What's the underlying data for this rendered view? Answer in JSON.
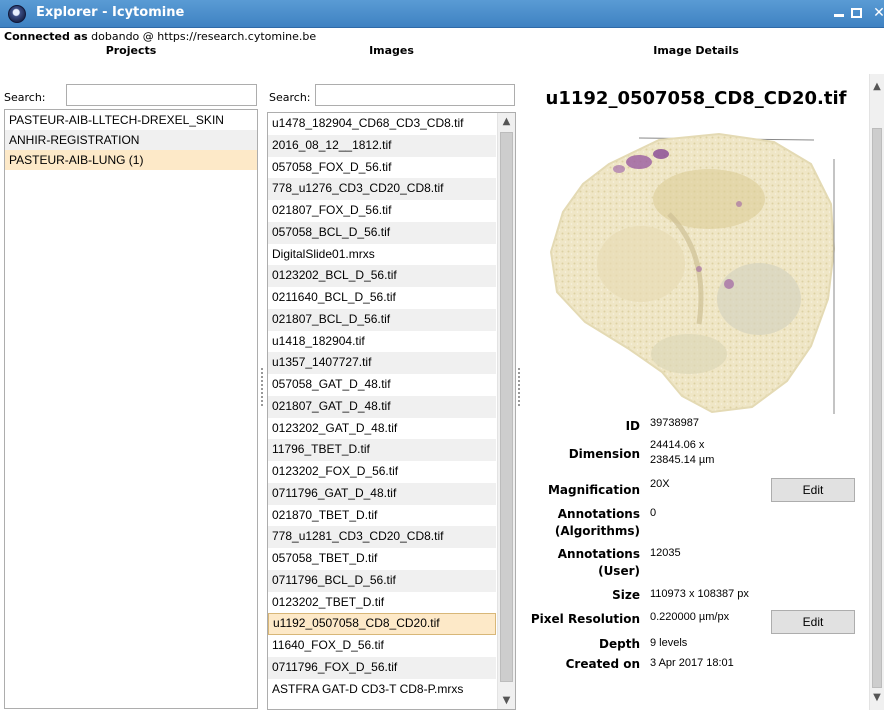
{
  "window": {
    "title": "Explorer - Icytomine",
    "minimize_icon": "minimize-icon",
    "maximize_icon": "maximize-icon",
    "close_glyph": "✕"
  },
  "connection": {
    "prefix": "Connected as",
    "user_host": "dobando @ https://research.cytomine.be"
  },
  "projects": {
    "header": "Projects",
    "search_label": "Search:",
    "search_value": "",
    "items": [
      "PASTEUR-AIB-LLTECH-DREXEL_SKIN",
      "ANHIR-REGISTRATION",
      "PASTEUR-AIB-LUNG (1)"
    ],
    "selected_index": 2
  },
  "images": {
    "header": "Images",
    "search_label": "Search:",
    "search_value": "",
    "items": [
      "u1478_182904_CD68_CD3_CD8.tif",
      "2016_08_12__1812.tif",
      "057058_FOX_D_56.tif",
      "778_u1276_CD3_CD20_CD8.tif",
      "021807_FOX_D_56.tif",
      "057058_BCL_D_56.tif",
      "DigitalSlide01.mrxs",
      "0123202_BCL_D_56.tif",
      "0211640_BCL_D_56.tif",
      "021807_BCL_D_56.tif",
      "u1418_182904.tif",
      "u1357_1407727.tif",
      "057058_GAT_D_48.tif",
      "021807_GAT_D_48.tif",
      "0123202_GAT_D_48.tif",
      "11796_TBET_D.tif",
      "0123202_FOX_D_56.tif",
      "0711796_GAT_D_48.tif",
      "021870_TBET_D.tif",
      "778_u1281_CD3_CD20_CD8.tif",
      "057058_TBET_D.tif",
      "0711796_BCL_D_56.tif",
      "0123202_TBET_D.tif",
      "u1192_0507058_CD8_CD20.tif",
      "11640_FOX_D_56.tif",
      "0711796_FOX_D_56.tif",
      "ASTFRA GAT-D CD3-T CD8-P.mrxs"
    ],
    "selected_index": 23
  },
  "details": {
    "header": "Image Details",
    "title": "u1192_0507058_CD8_CD20.tif",
    "thumbnail_icon": "tissue-slide-thumbnail",
    "fields": {
      "id_label": "ID",
      "id_value": "39738987",
      "dimension_label": "Dimension",
      "dimension_value_1": "24414.06 x",
      "dimension_value_2": "23845.14 µm",
      "magnification_label": "Magnification",
      "magnification_value": "20X",
      "annot_alg_label_1": "Annotations",
      "annot_alg_label_2": "(Algorithms)",
      "annot_alg_value": "0",
      "annot_user_label_1": "Annotations",
      "annot_user_label_2": "(User)",
      "annot_user_value": "12035",
      "size_label": "Size",
      "size_value": "110973 x 108387 px",
      "pixel_res_label": "Pixel Resolution",
      "pixel_res_value": "0.220000 µm/px",
      "depth_label": "Depth",
      "depth_value": "9 levels",
      "created_label": "Created on",
      "created_value": "3 Apr 2017 18:01"
    },
    "edit_label": "Edit"
  },
  "colors": {
    "titlebar": "#4a8fcf",
    "selection": "#fde9c8",
    "alt_row": "#f0f0f0"
  }
}
